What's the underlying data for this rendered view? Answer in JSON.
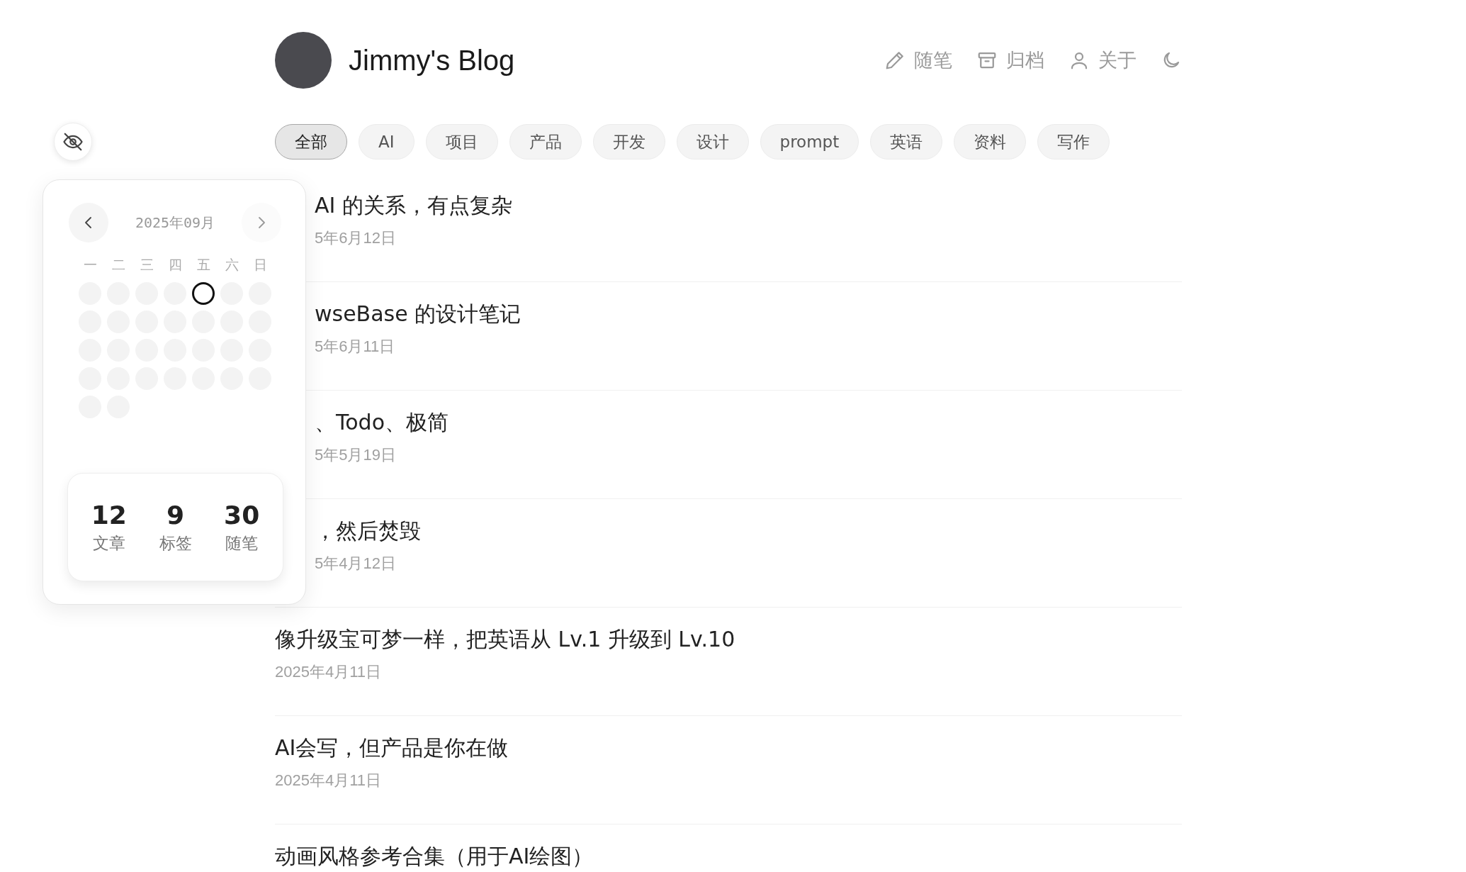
{
  "header": {
    "title": "Jimmy's Blog",
    "nav": [
      {
        "kind": "pencil",
        "label": "随笔"
      },
      {
        "kind": "archive",
        "label": "归档"
      },
      {
        "kind": "user",
        "label": "关于"
      },
      {
        "kind": "moon"
      }
    ]
  },
  "tags": [
    {
      "label": "全部",
      "selected": true
    },
    {
      "label": "AI",
      "selected": false
    },
    {
      "label": "项目",
      "selected": false
    },
    {
      "label": "产品",
      "selected": false
    },
    {
      "label": "开发",
      "selected": false
    },
    {
      "label": "设计",
      "selected": false
    },
    {
      "label": "prompt",
      "selected": false
    },
    {
      "label": "英语",
      "selected": false
    },
    {
      "label": "资料",
      "selected": false
    },
    {
      "label": "写作",
      "selected": false
    }
  ],
  "posts": [
    {
      "kind": "covered",
      "title": "AI 的关系，有点复杂",
      "date": "5年6月12日"
    },
    {
      "kind": "covered",
      "title": "wseBase 的设计笔记",
      "date": "5年6月11日"
    },
    {
      "kind": "covered",
      "title": "、Todo、极简",
      "date": "5年5月19日"
    },
    {
      "kind": "covered",
      "title": "，然后焚毁",
      "date": "5年4月12日"
    },
    {
      "kind": "full",
      "title": "像升级宝可梦一样，把英语从 Lv.1 升级到 Lv.10",
      "date": "2025年4月11日"
    },
    {
      "kind": "full",
      "title": "AI会写，但产品是你在做",
      "date": "2025年4月11日"
    },
    {
      "kind": "full",
      "title": "动画风格参考合集（用于AI绘图）"
    }
  ],
  "calendar": {
    "month": "2025年09月",
    "weekdays": [
      "一",
      "二",
      "三",
      "四",
      "五",
      "六",
      "日"
    ],
    "days": [
      {
        "selected": false
      },
      {
        "selected": false
      },
      {
        "selected": false
      },
      {
        "selected": false
      },
      {
        "selected": true
      },
      {
        "selected": false
      },
      {
        "selected": false
      },
      {
        "selected": false
      },
      {
        "selected": false
      },
      {
        "selected": false
      },
      {
        "selected": false
      },
      {
        "selected": false
      },
      {
        "selected": false
      },
      {
        "selected": false
      },
      {
        "selected": false
      },
      {
        "selected": false
      },
      {
        "selected": false
      },
      {
        "selected": false
      },
      {
        "selected": false
      },
      {
        "selected": false
      },
      {
        "selected": false
      },
      {
        "selected": false
      },
      {
        "selected": false
      },
      {
        "selected": false
      },
      {
        "selected": false
      },
      {
        "selected": false
      },
      {
        "selected": false
      },
      {
        "selected": false
      },
      {
        "selected": false
      },
      {
        "selected": false
      }
    ],
    "stats": [
      {
        "value": "12",
        "label": "文章"
      },
      {
        "value": "9",
        "label": "标签"
      },
      {
        "value": "30",
        "label": "随笔"
      }
    ]
  }
}
